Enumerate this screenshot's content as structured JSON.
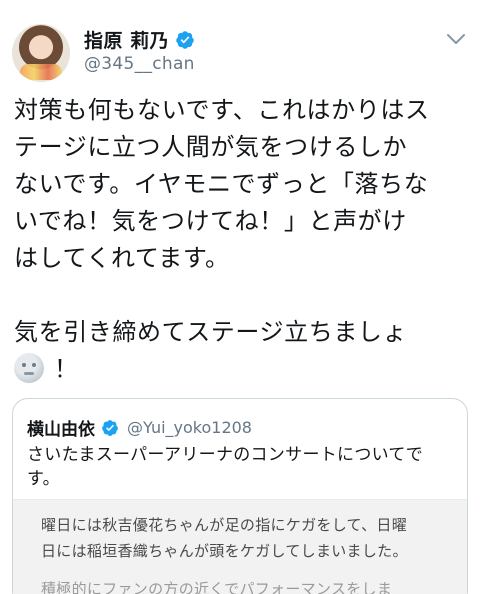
{
  "author": {
    "display_name": "指原 莉乃",
    "handle": "@345__chan",
    "verified": true
  },
  "tweet": {
    "lines": [
      "対策も何もないです、これはかりはス",
      "テージに立つ人間が気をつけるしか",
      "ないです。イヤモニでずっと「落ちな",
      "いでね！気をつけてね！」と声がけ",
      "はしてくれてます。"
    ],
    "lines2": [
      "気を引き締めてステージ立ちましょ"
    ],
    "last_line_suffix": "！",
    "emoji": "moon-face-icon"
  },
  "quoted_tweet": {
    "display_name": "横山由依",
    "handle": "@Yui_yoko1208",
    "verified": true,
    "text_lines": [
      "さいたまスーパーアリーナのコンサートについてで",
      "す。"
    ],
    "image_text_lines": [
      "曜日には秋吉優花ちゃんが足の指にケガをして、日曜",
      "日には稲垣香織ちゃんが頭をケガしてしまいました。",
      "積極的にファンの方の近くでパフォーマンスをしま"
    ]
  },
  "colors": {
    "verified_blue": "#1da1f2",
    "text": "#14171a",
    "secondary": "#657786",
    "border": "#ccd6dd"
  }
}
